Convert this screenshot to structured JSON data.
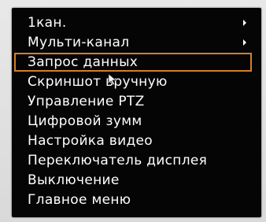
{
  "menu": {
    "items": [
      {
        "label": "1кан.",
        "has_submenu": true,
        "selected": false
      },
      {
        "label": "Мульти-канал",
        "has_submenu": true,
        "selected": false
      },
      {
        "label": "Запрос данных",
        "has_submenu": false,
        "selected": true
      },
      {
        "label": "Скриншот вручную",
        "has_submenu": false,
        "selected": false
      },
      {
        "label": "Управление PTZ",
        "has_submenu": false,
        "selected": false
      },
      {
        "label": "Цифровой зумм",
        "has_submenu": false,
        "selected": false
      },
      {
        "label": "Настройка видео",
        "has_submenu": false,
        "selected": false
      },
      {
        "label": "Переключатель дисплея",
        "has_submenu": false,
        "selected": false
      },
      {
        "label": "Выключение",
        "has_submenu": false,
        "selected": false
      },
      {
        "label": "Главное меню",
        "has_submenu": false,
        "selected": false
      }
    ],
    "highlight_color": "#d38028",
    "background_color": "#050505",
    "text_color": "#ffffff"
  }
}
